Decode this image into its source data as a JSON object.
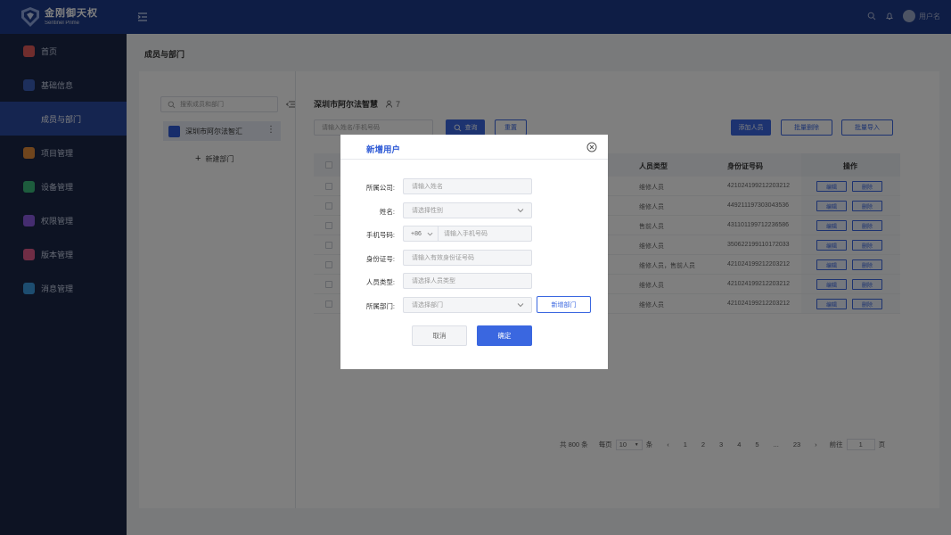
{
  "header": {
    "logo_cn": "金刚御天权",
    "logo_en": "Sentinel Prime",
    "username": "用户名"
  },
  "sidebar": {
    "items": [
      {
        "label": "首页",
        "color": "#e05a5a"
      },
      {
        "label": "基础信息",
        "color": "#3a5fb8"
      },
      {
        "label": "成员与部门",
        "color": "#ffffff"
      },
      {
        "label": "项目管理",
        "color": "#e08a3a"
      },
      {
        "label": "设备管理",
        "color": "#3ab87a"
      },
      {
        "label": "权限管理",
        "color": "#8a5ae0"
      },
      {
        "label": "版本管理",
        "color": "#e05a8a"
      },
      {
        "label": "消息管理",
        "color": "#3a9ae0"
      }
    ]
  },
  "page_title": "成员与部门",
  "tree": {
    "search_placeholder": "搜索成员和部门",
    "node_label": "深圳市阿尔法智汇",
    "new_dept": "新建部门"
  },
  "content": {
    "org_name": "深圳市阿尔法智慧",
    "member_count": "7",
    "query_placeholder": "请输入姓名/手机号码",
    "query_btn": "查询",
    "reset_btn": "重置",
    "add_btn": "添加人员",
    "batch_delete_btn": "批量删除",
    "batch_import_btn": "批量导入"
  },
  "table": {
    "headers": {
      "type": "人员类型",
      "id": "身份证号码",
      "ops": "操作"
    },
    "rows": [
      {
        "type": "维修人员",
        "id": "421024199212203212"
      },
      {
        "type": "维修人员",
        "id": "449211197303043536"
      },
      {
        "type": "售前人员",
        "id": "431101199712236586"
      },
      {
        "type": "维修人员",
        "id": "350622199110172033"
      },
      {
        "type": "维修人员，售前人员",
        "id": "421024199212203212"
      },
      {
        "type": "维修人员",
        "id": "421024199212203212"
      },
      {
        "type": "维修人员",
        "id": "421024199212203212"
      }
    ],
    "edit_label": "编辑",
    "delete_label": "删除"
  },
  "pager": {
    "total": "共 800 条",
    "per_page_label": "每页",
    "per_page": "10",
    "unit": "条",
    "pages": [
      "1",
      "2",
      "3",
      "4",
      "5",
      "...",
      "23"
    ],
    "goto_label": "前往",
    "goto_value": "1",
    "page_unit": "页"
  },
  "modal": {
    "title": "新增用户",
    "company_label": "所属公司:",
    "company_placeholder": "请输入姓名",
    "name_label": "姓名:",
    "name_placeholder": "请选择性别",
    "phone_label": "手机号码:",
    "phone_code": "+86",
    "phone_placeholder": "请输入手机号码",
    "id_label": "身份证号:",
    "id_placeholder": "请输入有效身份证号码",
    "type_label": "人员类型:",
    "type_placeholder": "请选择人员类型",
    "dept_label": "所属部门:",
    "dept_placeholder": "请选择部门",
    "new_dept_btn": "新增部门",
    "cancel": "取消",
    "confirm": "确定"
  }
}
